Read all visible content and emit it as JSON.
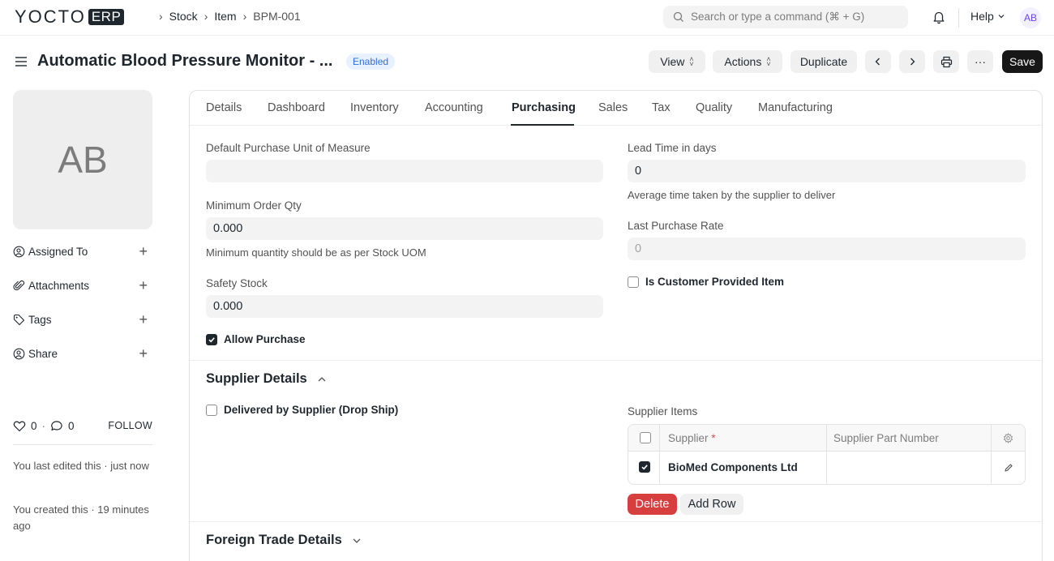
{
  "brand": {
    "logo_main": "YOCTO",
    "logo_badge": "ERP"
  },
  "breadcrumbs": [
    "Stock",
    "Item",
    "BPM-001"
  ],
  "search": {
    "placeholder": "Search or type a command (⌘ + G)"
  },
  "navbar": {
    "help_label": "Help",
    "avatar_initials": "AB"
  },
  "page": {
    "title": "Automatic Blood Pressure Monitor - ...",
    "status": "Enabled",
    "buttons": {
      "view": "View",
      "actions": "Actions",
      "duplicate": "Duplicate",
      "more": "···",
      "save": "Save"
    }
  },
  "sidebar": {
    "avatar_initials": "AB",
    "items": [
      {
        "label": "Assigned To",
        "icon": "user-plus-icon"
      },
      {
        "label": "Attachments",
        "icon": "paperclip-icon"
      },
      {
        "label": "Tags",
        "icon": "tag-icon"
      },
      {
        "label": "Share",
        "icon": "share-user-icon"
      }
    ],
    "likes": "0",
    "comments": "0",
    "follow_label": "FOLLOW",
    "last_edited": "You last edited this · just now",
    "created": "You created this · 19 minutes ago"
  },
  "tabs": [
    "Details",
    "Dashboard",
    "Inventory",
    "Accounting",
    "Purchasing",
    "Sales",
    "Tax",
    "Quality",
    "Manufacturing"
  ],
  "active_tab": "Purchasing",
  "purchasing": {
    "default_uom": {
      "label": "Default Purchase Unit of Measure",
      "value": ""
    },
    "min_order_qty": {
      "label": "Minimum Order Qty",
      "value": "0.000",
      "help": "Minimum quantity should be as per Stock UOM"
    },
    "safety_stock": {
      "label": "Safety Stock",
      "value": "0.000"
    },
    "allow_purchase": {
      "label": "Allow Purchase",
      "checked": true
    },
    "lead_time": {
      "label": "Lead Time in days",
      "value": "0",
      "help": "Average time taken by the supplier to deliver"
    },
    "last_purchase_rate": {
      "label": "Last Purchase Rate",
      "value": "0"
    },
    "customer_provided": {
      "label": "Is Customer Provided Item",
      "checked": false
    }
  },
  "supplier_details": {
    "title": "Supplier Details",
    "drop_ship": {
      "label": "Delivered by Supplier (Drop Ship)",
      "checked": false
    },
    "supplier_items": {
      "label": "Supplier Items",
      "columns": [
        "Supplier",
        "Supplier Part Number"
      ],
      "required_mark": "*",
      "rows": [
        {
          "supplier": "BioMed Components Ltd",
          "part_number": "",
          "selected": true
        }
      ],
      "delete_label": "Delete",
      "add_row_label": "Add Row"
    }
  },
  "foreign_trade": {
    "title": "Foreign Trade Details"
  },
  "colors": {
    "primary_dark": "#171717",
    "danger": "#d73e3e",
    "status_blue": "#2f6fdb",
    "status_bg": "#e8f1ff"
  }
}
